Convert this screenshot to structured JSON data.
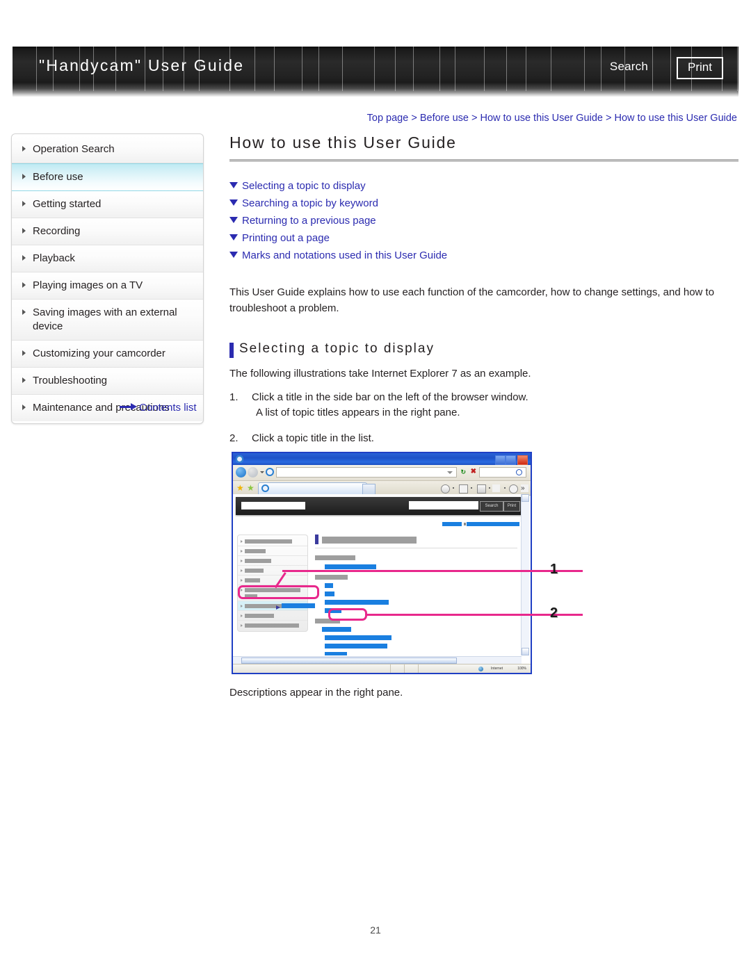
{
  "header": {
    "title": "\"Handycam\" User Guide",
    "search_label": "Search",
    "print_label": "Print"
  },
  "breadcrumb": {
    "text": "Top page > Before use > How to use this User Guide > How to use this User Guide"
  },
  "sidebar": {
    "items": [
      {
        "label": "Operation Search",
        "active": false
      },
      {
        "label": "Before use",
        "active": true
      },
      {
        "label": "Getting started",
        "active": false
      },
      {
        "label": "Recording",
        "active": false
      },
      {
        "label": "Playback",
        "active": false
      },
      {
        "label": "Playing images on a TV",
        "active": false
      },
      {
        "label": "Saving images with an external device",
        "active": false
      },
      {
        "label": "Customizing your camcorder",
        "active": false
      },
      {
        "label": "Troubleshooting",
        "active": false
      },
      {
        "label": "Maintenance and precautions",
        "active": false
      }
    ],
    "contents_list_label": "Contents list"
  },
  "main": {
    "page_title": "How to use this User Guide",
    "anchor_links": [
      "Selecting a topic to display",
      "Searching a topic by keyword",
      "Returning to a previous page",
      "Printing out a page",
      "Marks and notations used in this User Guide"
    ],
    "intro_paragraph": "This User Guide explains how to use each function of the camcorder, how to change settings, and how to troubleshoot a problem.",
    "sub_heading": "Selecting a topic to display",
    "example_line": "The following illustrations take Internet Explorer 7 as an example.",
    "steps": [
      {
        "num": "1.",
        "text": "Click a title in the side bar on the left of the browser window.",
        "sub": "A list of topic titles appears in the right pane."
      },
      {
        "num": "2.",
        "text": "Click a topic title in the list.",
        "sub": ""
      }
    ],
    "caption": "Descriptions appear in the right pane."
  },
  "illustration": {
    "mini_search_button": "Search",
    "mini_print_button": "Print",
    "status_text": "Internet",
    "status_zoom": "100%",
    "callout_1": "1",
    "callout_2": "2"
  },
  "footer": {
    "page_number": "21"
  },
  "colors": {
    "link_blue": "#2b2bb0",
    "accent_blue": "#1a7fe0",
    "callout_pink": "#e8288c",
    "active_cyan": "#bfeaf3",
    "header_black": "#1e1e1e"
  }
}
